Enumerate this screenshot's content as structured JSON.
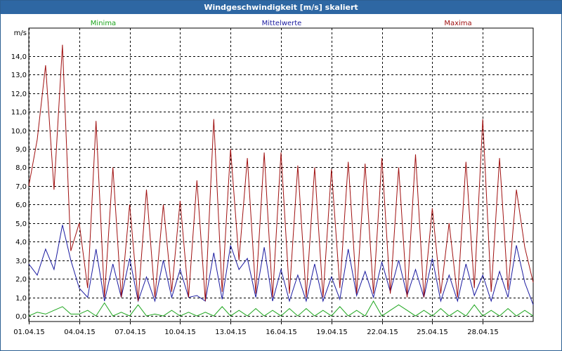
{
  "window": {
    "title": "Windgeschwindigkeit [m/s] skaliert"
  },
  "colors": {
    "min": "#1ca51c",
    "mean": "#1a1aa0",
    "max": "#a01010",
    "grid": "#000000",
    "title_bg": "#2e67a3"
  },
  "chart_data": {
    "type": "line",
    "title": "Windgeschwindigkeit [m/s] skaliert",
    "ylabel": "m/s",
    "xlabel": "",
    "ylim": [
      -0.3,
      15.5
    ],
    "xlim": [
      0,
      30
    ],
    "grid": true,
    "legend": [
      "Minima",
      "Mittelwerte",
      "Maxima"
    ],
    "yticks": [
      0,
      1,
      2,
      3,
      4,
      5,
      6,
      7,
      8,
      9,
      10,
      11,
      12,
      13,
      14
    ],
    "ytick_labels": [
      "0,0",
      "1,0",
      "2,0",
      "3,0",
      "4,0",
      "5,0",
      "6,0",
      "7,0",
      "8,0",
      "9,0",
      "10,0",
      "11,0",
      "12,0",
      "13,0",
      "14,0"
    ],
    "xticks": [
      0,
      3,
      6,
      9,
      12,
      15,
      18,
      21,
      24,
      27
    ],
    "xtick_labels": [
      "01.04.15",
      "04.04.15",
      "07.04.15",
      "10.04.15",
      "13.04.15",
      "16.04.15",
      "19.04.15",
      "22.04.15",
      "25.04.15",
      "28.04.15"
    ],
    "x": [
      0,
      0.5,
      1,
      1.5,
      2,
      2.5,
      3,
      3.5,
      4,
      4.5,
      5,
      5.5,
      6,
      6.5,
      7,
      7.5,
      8,
      8.5,
      9,
      9.5,
      10,
      10.5,
      11,
      11.5,
      12,
      12.5,
      13,
      13.5,
      14,
      14.5,
      15,
      15.5,
      16,
      16.5,
      17,
      17.5,
      18,
      18.5,
      19,
      19.5,
      20,
      20.5,
      21,
      21.5,
      22,
      22.5,
      23,
      23.5,
      24,
      24.5,
      25,
      25.5,
      26,
      26.5,
      27,
      27.5,
      28,
      28.5,
      29,
      29.5,
      30
    ],
    "series": [
      {
        "name": "Minima",
        "values": [
          0.0,
          0.2,
          0.1,
          0.3,
          0.5,
          0.1,
          0.1,
          0.3,
          0.0,
          0.7,
          0.0,
          0.2,
          0.0,
          0.6,
          0.0,
          0.1,
          0.0,
          0.3,
          0.0,
          0.2,
          0.0,
          0.2,
          0.0,
          0.5,
          0.0,
          0.3,
          0.0,
          0.4,
          0.0,
          0.3,
          0.0,
          0.4,
          0.0,
          0.4,
          0.0,
          0.3,
          0.0,
          0.5,
          0.0,
          0.3,
          0.0,
          0.8,
          0.0,
          0.3,
          0.6,
          0.3,
          0.0,
          0.3,
          0.0,
          0.4,
          0.0,
          0.3,
          0.0,
          0.6,
          0.0,
          0.3,
          0.0,
          0.4,
          0.0,
          0.3,
          0.0
        ]
      },
      {
        "name": "Mittelwerte",
        "values": [
          2.8,
          2.2,
          3.6,
          2.5,
          4.9,
          3.0,
          1.5,
          1.0,
          3.6,
          0.8,
          2.8,
          1.0,
          3.1,
          0.8,
          2.1,
          0.8,
          3.0,
          1.0,
          2.5,
          1.0,
          1.1,
          0.8,
          3.4,
          0.9,
          3.8,
          2.5,
          3.1,
          1.0,
          3.7,
          0.8,
          2.5,
          0.8,
          2.2,
          0.8,
          2.8,
          0.8,
          2.1,
          0.9,
          3.6,
          1.1,
          2.4,
          1.0,
          2.9,
          1.3,
          3.0,
          1.1,
          2.5,
          1.0,
          3.1,
          0.8,
          2.2,
          0.8,
          2.8,
          1.1,
          2.2,
          0.8,
          2.4,
          1.0,
          3.8,
          1.8,
          0.6
        ]
      },
      {
        "name": "Maxima",
        "values": [
          7.0,
          9.5,
          13.5,
          6.8,
          14.6,
          3.5,
          5.0,
          1.5,
          10.5,
          1.0,
          8.0,
          1.0,
          6.0,
          0.8,
          6.8,
          1.0,
          6.0,
          1.3,
          6.2,
          1.0,
          7.3,
          0.8,
          10.6,
          1.3,
          9.0,
          3.0,
          8.5,
          1.2,
          8.8,
          1.0,
          8.8,
          1.2,
          8.1,
          1.0,
          8.0,
          1.0,
          7.9,
          1.5,
          8.3,
          1.2,
          8.2,
          1.2,
          8.5,
          1.2,
          8.0,
          1.0,
          8.7,
          1.0,
          5.8,
          1.2,
          5.0,
          1.0,
          8.3,
          1.5,
          10.6,
          1.3,
          8.5,
          1.4,
          6.8,
          3.7,
          1.8
        ]
      }
    ]
  }
}
